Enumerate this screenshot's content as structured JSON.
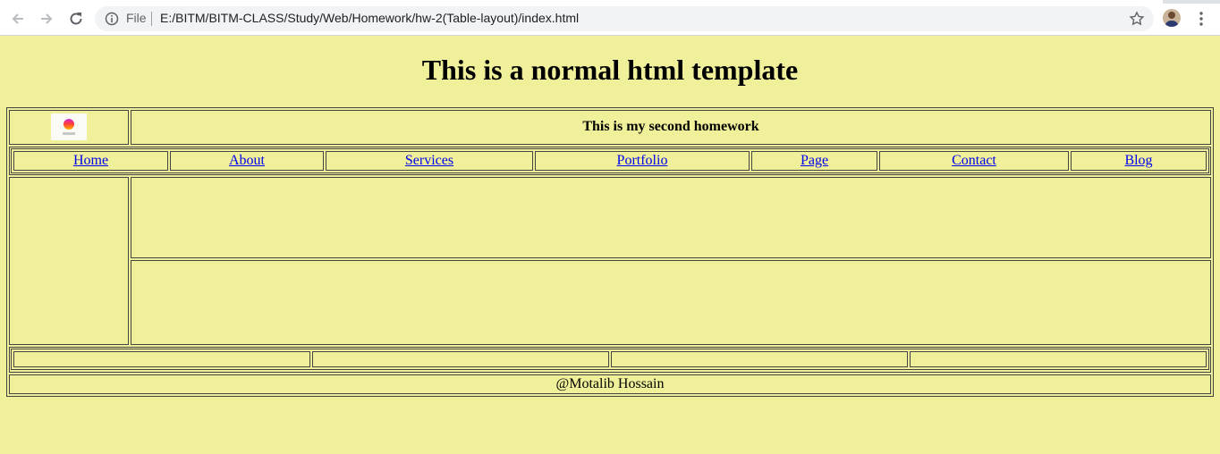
{
  "browser": {
    "file_label": "File",
    "url": "E:/BITM/BITM-CLASS/Study/Web/Homework/hw-2(Table-layout)/index.html"
  },
  "page": {
    "title": "This is a normal html template",
    "header_text": "This is my second homework",
    "nav": [
      {
        "label": "Home"
      },
      {
        "label": "About"
      },
      {
        "label": "Services"
      },
      {
        "label": "Portfolio"
      },
      {
        "label": "Page"
      },
      {
        "label": "Contact"
      },
      {
        "label": "Blog"
      }
    ],
    "footer": "@Motalib Hossain"
  },
  "colors": {
    "page_background": "#f0ef9a",
    "link": "#0000ee"
  }
}
